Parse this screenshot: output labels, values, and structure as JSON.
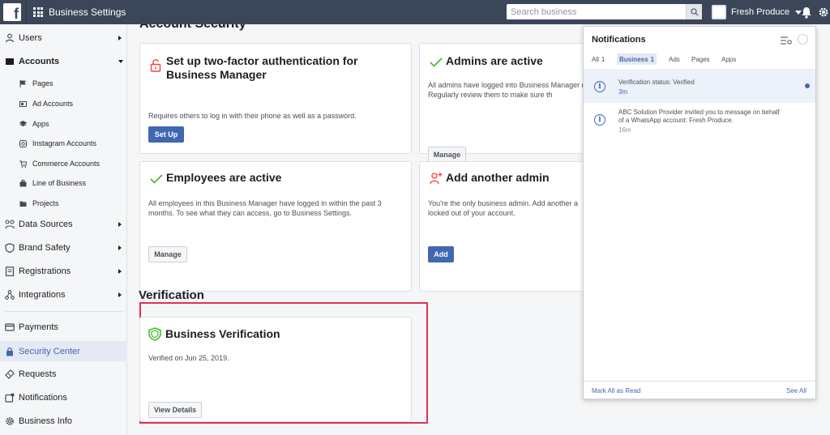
{
  "app": {
    "logo": "f",
    "title": "Business Settings"
  },
  "search": {
    "placeholder": "Search business",
    "value": ""
  },
  "account": {
    "name": "Fresh Produce"
  },
  "sidebar": {
    "items": [
      {
        "label": "Users",
        "icon": "users-icon"
      },
      {
        "label": "Accounts",
        "icon": "accounts-icon"
      },
      {
        "label": "Pages",
        "icon": "flag-icon"
      },
      {
        "label": "Ad Accounts",
        "icon": "ad-accounts-icon"
      },
      {
        "label": "Apps",
        "icon": "apps-icon"
      },
      {
        "label": "Instagram Accounts",
        "icon": "instagram-icon"
      },
      {
        "label": "Commerce Accounts",
        "icon": "cart-icon"
      },
      {
        "label": "Line of Business",
        "icon": "line-of-business-icon"
      },
      {
        "label": "Projects",
        "icon": "folder-icon"
      },
      {
        "label": "Data Sources",
        "icon": "data-sources-icon"
      },
      {
        "label": "Brand Safety",
        "icon": "shield-icon"
      },
      {
        "label": "Registrations",
        "icon": "registrations-icon"
      },
      {
        "label": "Integrations",
        "icon": "integrations-icon"
      },
      {
        "label": "Payments",
        "icon": "card-icon"
      },
      {
        "label": "Security Center",
        "icon": "lock-icon"
      },
      {
        "label": "Requests",
        "icon": "requests-icon"
      },
      {
        "label": "Notifications",
        "icon": "notifications-icon"
      },
      {
        "label": "Business Info",
        "icon": "gear-icon"
      }
    ]
  },
  "main": {
    "section_partial": "Account Security",
    "cards": {
      "two_factor": {
        "title": "Set up two-factor authentication for Business Manager",
        "desc": "Requires others to log in with their phone as well as a password.",
        "button": "Set Up"
      },
      "admins": {
        "title": "Admins are active",
        "desc": "All admins have logged into Business Manager months. Regularly review them to make sure th",
        "button": "Manage"
      },
      "employees": {
        "title": "Employees are active",
        "desc": "All employees in this Business Manager have logged in within the past 3 months. To see what they can access, go to Business Settings.",
        "button": "Manage"
      },
      "add_admin": {
        "title": "Add another admin",
        "desc": "You're the only business admin. Add another a locked out of your account.",
        "button": "Add"
      }
    },
    "verification": {
      "heading": "Verification",
      "title": "Business Verification",
      "desc": "Verified on Jun 25, 2019.",
      "button": "View Details"
    }
  },
  "notifications": {
    "title": "Notifications",
    "tabs": [
      {
        "label": "All",
        "count": "1"
      },
      {
        "label": "Business",
        "count": "1"
      },
      {
        "label": "Ads"
      },
      {
        "label": "Pages"
      },
      {
        "label": "Apps"
      }
    ],
    "items": [
      {
        "text": "Verification status: Verified",
        "time": "3m",
        "unread": true
      },
      {
        "text": "ABC Solution Provider invited you to message on behalf of a WhatsApp account: Fresh Produce.",
        "time": "16m",
        "unread": false
      }
    ],
    "mark_all": "Mark All as Read",
    "see_all": "See All"
  },
  "colors": {
    "topbar": "#3b4759",
    "brand_blue": "#4267b2",
    "success_green": "#42b72a",
    "alert_red": "#fa3e3e",
    "frame_red": "#dd3355"
  }
}
